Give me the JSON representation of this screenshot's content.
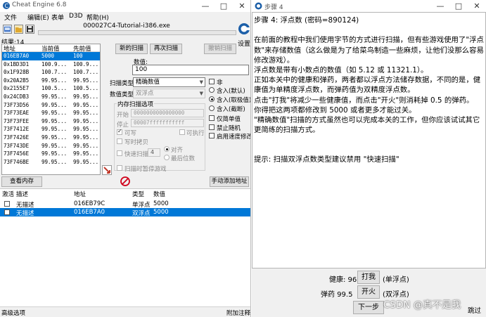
{
  "cheat_engine": {
    "window_title": "Cheat Engine 6.8",
    "menu": [
      "文件",
      "编辑(E)",
      "表单",
      "D3D",
      "帮助(H)"
    ],
    "process_name": "000027C4-Tutorial-i386.exe",
    "logo_label": "设置",
    "found_label": "结果:14",
    "list_headers": [
      "地址",
      "当前值",
      "先前值"
    ],
    "found_rows": [
      {
        "address": "016EB7A0",
        "current": "5000",
        "previous": "100"
      },
      {
        "address": "0x1BD3D1",
        "current": "100.9...",
        "previous": "100.9..."
      },
      {
        "address": "0x1F928B",
        "current": "100.7...",
        "previous": "100.7..."
      },
      {
        "address": "0x20A2B5",
        "current": "99.95...",
        "previous": "99.95..."
      },
      {
        "address": "0x2155E7",
        "current": "100.5...",
        "previous": "100.5..."
      },
      {
        "address": "0x24CDB3",
        "current": "99.95...",
        "previous": "99.95..."
      },
      {
        "address": "73F73D56",
        "current": "99.95...",
        "previous": "99.95..."
      },
      {
        "address": "73F73EAE",
        "current": "99.95...",
        "previous": "99.95..."
      },
      {
        "address": "73F73FEE",
        "current": "99.95...",
        "previous": "99.95..."
      },
      {
        "address": "73F7412E",
        "current": "99.95...",
        "previous": "99.95..."
      },
      {
        "address": "73F7426E",
        "current": "99.95...",
        "previous": "99.95..."
      },
      {
        "address": "73F743DE",
        "current": "99.95...",
        "previous": "99.95..."
      },
      {
        "address": "73F7456E",
        "current": "99.95...",
        "previous": "99.95..."
      },
      {
        "address": "73F746BE",
        "current": "99.95...",
        "previous": "99.95..."
      }
    ],
    "new_scan": "新的扫描",
    "next_scan": "再次扫描",
    "undo_scan": "撤销扫描",
    "value_label": "数值:",
    "value": "100",
    "scan_type_label": "扫描类型",
    "scan_type": "精确数值",
    "value_type_label": "数值类型",
    "value_type": "双浮点",
    "mem_options_label": "内存扫描选项",
    "start_label": "开始",
    "start_value": "0000000000000000",
    "stop_label": "停止",
    "stop_value": "00007fffffffffff",
    "writable": "可写",
    "executable": "可执行",
    "copy_on_write": "写时拷贝",
    "fast_scan": "快速扫描",
    "fast_scan_value": "4",
    "align": "对齐",
    "last_digits": "最后位数",
    "pause_game": "扫描时暂停游戏",
    "not_label": "非",
    "radio_rounded": "含入(默认)",
    "radio_extreme": "含入(取极值)",
    "radio_truncated": "含入(截断)",
    "unicode_only": "仅简单值",
    "disable_random": "禁止随机",
    "speedhack": "启用速度修改",
    "view_memory": "查看内存",
    "add_address": "手动添加地址",
    "results_headers": [
      "激活",
      "描述",
      "地址",
      "类型",
      "数值"
    ],
    "results_rows": [
      {
        "description": "无描述",
        "address": "016EB79C",
        "type": "单浮点",
        "value": "5000"
      },
      {
        "description": "无描述",
        "address": "016EB7A0",
        "type": "双浮点",
        "value": "5000"
      }
    ],
    "advanced_options": "高级选项",
    "table_extras": "附加注释"
  },
  "tutorial": {
    "window_title": "步骤 4",
    "heading": "步骤 4: 浮点数 (密码=890124)",
    "paragraph1": "在前面的教程中我们使用字节的方式进行扫描，但有些游戏使用了\"浮点数\"来存储数值（这么做是为了给菜鸟制造一些麻烦，让他们没那么容易修改游戏）。",
    "lines": [
      "浮点数是带有小数点的数值（如 5.12 或 11321.1）。",
      "正如本关中的健康和弹药，两者都以浮点方法储存数据，不同的是，健康值为单精度浮点数，而弹药值为双精度浮点数。",
      "点击\"打我\"将减少一些健康值，而点击\"开火\"则消耗掉 0.5 的弹药。",
      "你得把这两项都修改到 5000 或者更多才能过关。",
      "\"精确数值\"扫描的方式虽然也可以完成本关的工作，但你应该试试其它更简练的扫描方式。"
    ],
    "hint": "提示: 扫描双浮点数类型建议禁用 \"快速扫描\"",
    "health_label": "健康: 96",
    "hit_me": "打我",
    "float_note": "(单浮点)",
    "ammo_label": "弹药 99.5",
    "fire": "开火",
    "double_note": "(双浮点)",
    "next": "下一步",
    "skip": "跳过"
  },
  "watermark": "CSDN @真不是我"
}
